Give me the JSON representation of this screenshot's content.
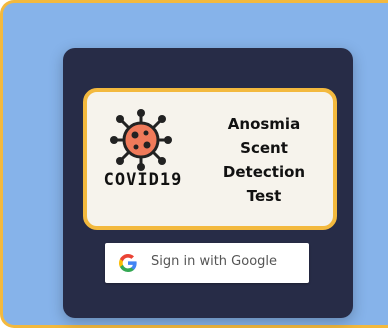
{
  "logo": {
    "covid_text": "COVID19",
    "title_lines": [
      "Anosmia",
      "Scent",
      "Detection",
      "Test"
    ],
    "virus_color": "#f07a5a"
  },
  "auth": {
    "google_button_label": "Sign in with Google",
    "icon": "google-icon"
  },
  "colors": {
    "background": "#86b3ea",
    "border_accent": "#f3b93e",
    "card": "#272c47",
    "logo_panel": "#f6f3ec"
  }
}
